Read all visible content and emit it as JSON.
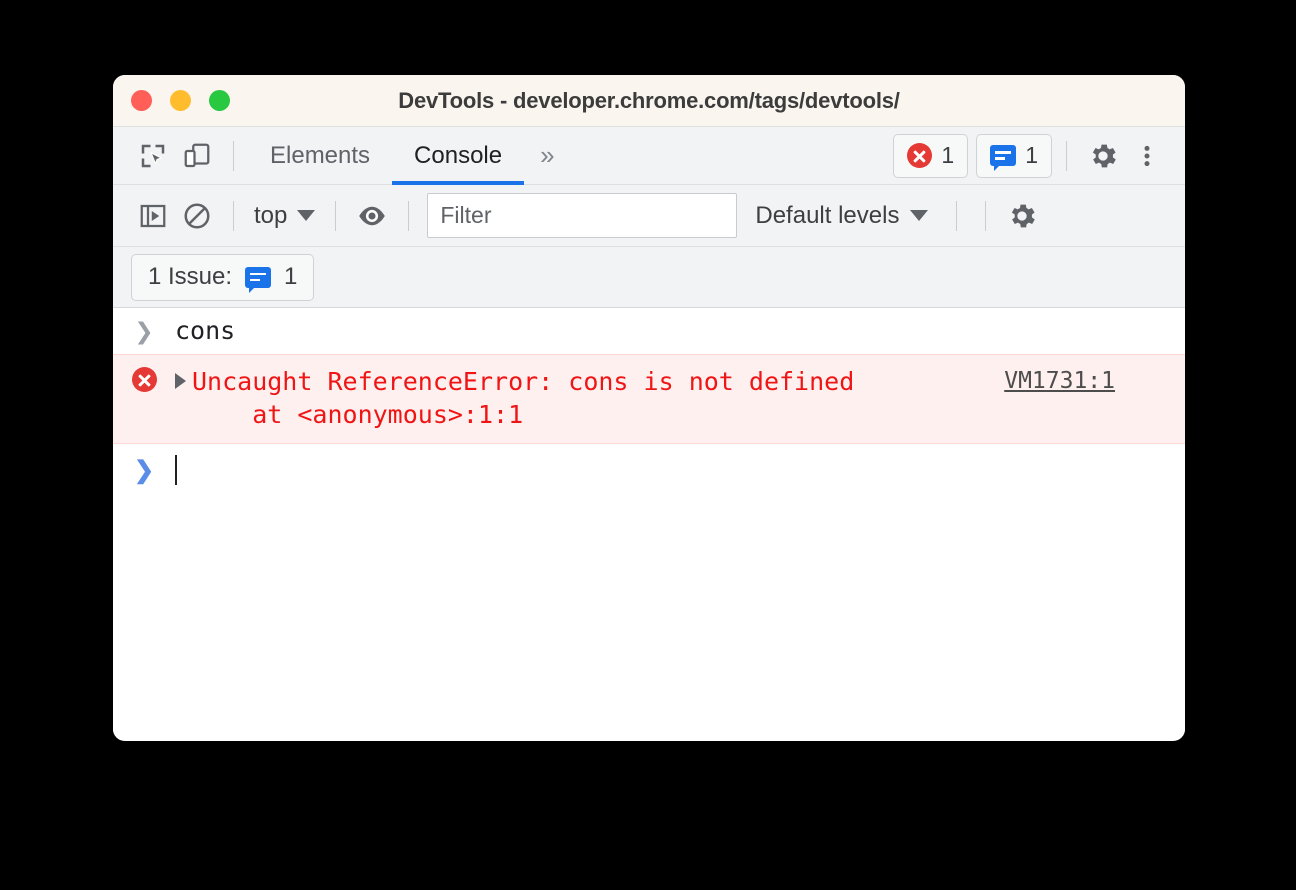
{
  "window": {
    "title": "DevTools - developer.chrome.com/tags/devtools/",
    "traffic_lights": [
      {
        "name": "close",
        "color": "#ff5f57"
      },
      {
        "name": "minimize",
        "color": "#ffbd2e"
      },
      {
        "name": "maximize",
        "color": "#28c840"
      }
    ]
  },
  "main_toolbar": {
    "inspect_icon": "inspect-element-icon",
    "device_icon": "device-toolbar-icon",
    "tabs": [
      {
        "label": "Elements",
        "selected": false
      },
      {
        "label": "Console",
        "selected": true
      }
    ],
    "more_tabs_label": "»",
    "error_count": "1",
    "issue_count": "1",
    "settings_icon": "gear-icon",
    "more_icon": "three-dot-menu-icon"
  },
  "console_toolbar": {
    "sidebar_toggle_icon": "console-sidebar-icon",
    "clear_icon": "clear-console-icon",
    "context_label": "top",
    "eye_icon": "live-expression-eye-icon",
    "filter": {
      "value": "",
      "placeholder": "Filter"
    },
    "levels_label": "Default levels",
    "settings_icon": "console-settings-gear-icon"
  },
  "issues_bar": {
    "label": "1 Issue:",
    "count": "1"
  },
  "console": {
    "input_entry": "cons",
    "error": {
      "message": "Uncaught ReferenceError: cons is not defined\n    at <anonymous>:1:1",
      "source": "VM1731:1"
    },
    "prompt_value": ""
  },
  "colors": {
    "accent": "#1a73e8",
    "error_red": "#f01515",
    "error_bg": "#fff0f0",
    "toolbar_bg": "#f1f3f4",
    "titlebar_bg": "#faf5ef"
  }
}
